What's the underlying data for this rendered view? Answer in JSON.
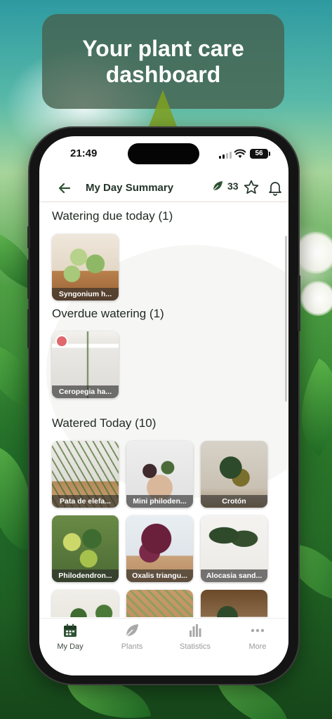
{
  "banner": {
    "title": "Your plant care\ndashboard"
  },
  "status_bar": {
    "time": "21:49",
    "battery": "56"
  },
  "header": {
    "title": "My Day Summary",
    "points": "33",
    "back_icon": "arrow-left-icon",
    "points_icon": "leaf-icon",
    "favorite_icon": "star-icon",
    "notification_icon": "bell-icon"
  },
  "sections": {
    "watering_due": {
      "title": "Watering due today (1)",
      "plants": [
        {
          "name": "Syngonium h..."
        }
      ]
    },
    "overdue": {
      "title": "Overdue watering (1)",
      "plants": [
        {
          "name": "Ceropegia ha...",
          "badge_icon": "watering-alert-icon"
        }
      ]
    },
    "watered_today": {
      "title": "Watered Today (10)",
      "plants": [
        {
          "name": "Pata de elefa..."
        },
        {
          "name": "Mini philoden..."
        },
        {
          "name": "Crotón"
        },
        {
          "name": "Philodendron..."
        },
        {
          "name": "Oxalis triangu..."
        },
        {
          "name": "Alocasia sand..."
        },
        {
          "name": ""
        },
        {
          "name": ""
        },
        {
          "name": ""
        }
      ]
    }
  },
  "tab_bar": {
    "tabs": [
      {
        "label": "My Day",
        "icon": "calendar-icon",
        "active": true
      },
      {
        "label": "Plants",
        "icon": "leaf-icon",
        "active": false
      },
      {
        "label": "Statistics",
        "icon": "bar-chart-icon",
        "active": false
      },
      {
        "label": "More",
        "icon": "more-dots-icon",
        "active": false
      }
    ]
  },
  "colors": {
    "accent_dark_green": "#2f5233",
    "header_text": "#24352a",
    "inactive_tab": "#9a9a9a",
    "alert_badge": "#e0676b"
  }
}
